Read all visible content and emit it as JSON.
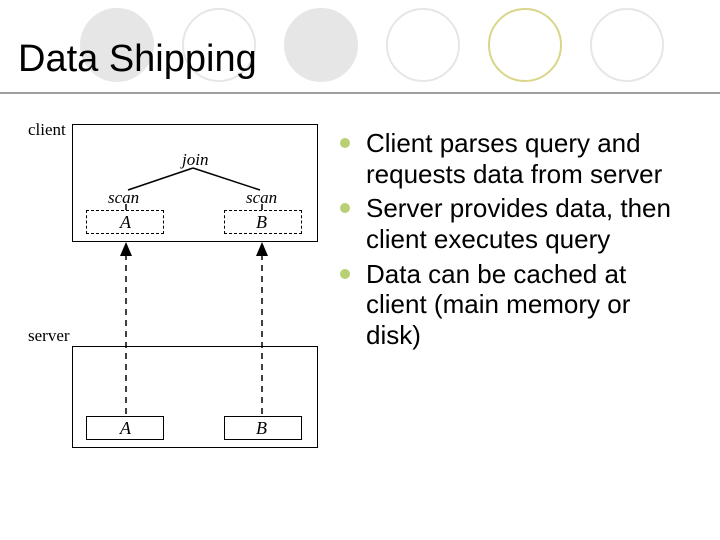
{
  "decor": {
    "circle_count": 6,
    "filled_indices": [
      0,
      2
    ],
    "accent_index": 4
  },
  "title": "Data Shipping",
  "diagram": {
    "client_label": "client",
    "server_label": "server",
    "join_label": "join",
    "scan_left": "scan",
    "scan_right": "scan",
    "box_a": "A",
    "box_b": "B",
    "server_box_a": "A",
    "server_box_b": "B"
  },
  "bullets": [
    "Client parses query and requests data from server",
    "Server provides data, then client executes query",
    "Data can be cached at client (main memory or disk)"
  ]
}
